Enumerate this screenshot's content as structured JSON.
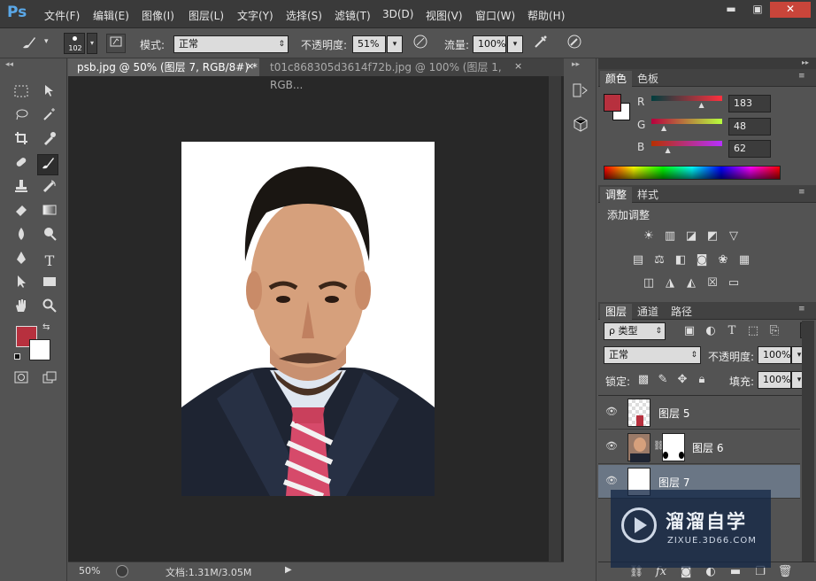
{
  "app": {
    "logo": "Ps"
  },
  "menu": [
    "文件(F)",
    "编辑(E)",
    "图像(I)",
    "图层(L)",
    "文字(Y)",
    "选择(S)",
    "滤镜(T)",
    "3D(D)",
    "视图(V)",
    "窗口(W)",
    "帮助(H)"
  ],
  "window_controls": {
    "minimize": "▬",
    "restore": "▣",
    "close": "✕"
  },
  "options": {
    "brush_size": "102",
    "mode_label": "模式:",
    "mode_value": "正常",
    "opacity_label": "不透明度:",
    "opacity_value": "51%",
    "flow_label": "流量:",
    "flow_value": "100%"
  },
  "tabs": [
    {
      "label": "psb.jpg @ 50% (图层 7, RGB/8#) *",
      "close": "×",
      "active": true
    },
    {
      "label": "t01c868305d3614f72b.jpg @ 100% (图层 1, RGB...",
      "close": "×",
      "active": false
    }
  ],
  "status": {
    "zoom": "50%",
    "doc": "文档:1.31M/3.05M"
  },
  "color_panel": {
    "tabs": [
      "颜色",
      "色板"
    ],
    "r_label": "R",
    "r_value": "183",
    "g_label": "G",
    "g_value": "48",
    "b_label": "B",
    "b_value": "62",
    "r_fraction": 0.718,
    "g_fraction": 0.188,
    "b_fraction": 0.243,
    "foreground": "#b7303e",
    "background": "#ffffff"
  },
  "adjust_panel": {
    "tabs": [
      "调整",
      "样式"
    ],
    "title": "添加调整"
  },
  "layers_panel": {
    "tabs": [
      "图层",
      "通道",
      "路径"
    ],
    "filter_label": "ρ 类型",
    "blend_mode": "正常",
    "opacity_label": "不透明度:",
    "opacity_value": "100%",
    "lock_label": "锁定:",
    "fill_label": "填充:",
    "fill_value": "100%",
    "layers": [
      {
        "name": "图层 5",
        "selected": false
      },
      {
        "name": "图层 6",
        "selected": false
      },
      {
        "name": "图层 7",
        "selected": true
      }
    ]
  },
  "watermark": {
    "title": "溜溜自学",
    "url": "ZIXUE.3D66.COM"
  }
}
